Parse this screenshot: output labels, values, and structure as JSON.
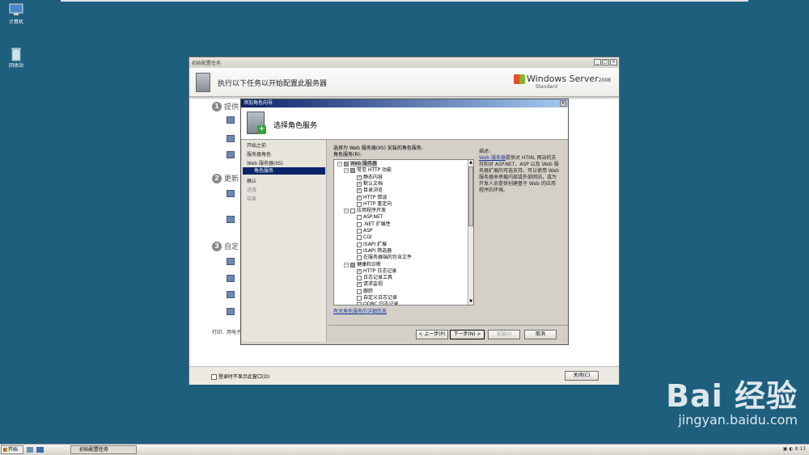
{
  "desktop": {
    "icons": [
      {
        "label": "计算机",
        "icon": "computer-icon"
      },
      {
        "label": "回收站",
        "icon": "recycle-bin-icon"
      }
    ]
  },
  "main_window": {
    "title": "初始配置任务",
    "header_title": "执行以下任务以开始配置此服务器",
    "brand": {
      "name": "Windows Server",
      "year": "2008",
      "edition": "Standard"
    },
    "steps": [
      {
        "num": "1",
        "label": "提供"
      },
      {
        "num": "2",
        "label": "更新"
      },
      {
        "num": "3",
        "label": "自定"
      }
    ],
    "print_text": "打印、用电子",
    "footer_checkbox_label": "登录时不显示此窗口(D)",
    "close_label": "关闭(C)"
  },
  "wizard": {
    "title": "添加角色向导",
    "header_title": "选择角色服务",
    "nav": [
      {
        "label": "开始之前",
        "state": "normal"
      },
      {
        "label": "服务器角色",
        "state": "normal"
      },
      {
        "label": "Web 服务器(IIS)",
        "state": "normal"
      },
      {
        "label": "角色服务",
        "state": "selected"
      },
      {
        "label": "确认",
        "state": "normal"
      },
      {
        "label": "进度",
        "state": "dim"
      },
      {
        "label": "结果",
        "state": "dim"
      }
    ],
    "instruction": "选择为 Web 服务器(IIS) 安装的角色服务:",
    "role_services_label": "角色服务(R):",
    "tree": [
      {
        "label": "Web 服务器",
        "level": 0,
        "expand": "−",
        "check": "partial",
        "selected": true
      },
      {
        "label": "常见 HTTP 功能",
        "level": 1,
        "expand": "−",
        "check": "partial"
      },
      {
        "label": "静态内容",
        "level": 2,
        "check": "checked"
      },
      {
        "label": "默认文档",
        "level": 2,
        "check": "checked"
      },
      {
        "label": "目录浏览",
        "level": 2,
        "check": "checked"
      },
      {
        "label": "HTTP 错误",
        "level": 2,
        "check": "checked"
      },
      {
        "label": "HTTP 重定向",
        "level": 2,
        "check": "unchecked"
      },
      {
        "label": "应用程序开发",
        "level": 1,
        "expand": "−",
        "check": "unchecked"
      },
      {
        "label": "ASP.NET",
        "level": 2,
        "check": "unchecked"
      },
      {
        "label": ".NET 扩展性",
        "level": 2,
        "check": "unchecked"
      },
      {
        "label": "ASP",
        "level": 2,
        "check": "unchecked"
      },
      {
        "label": "CGI",
        "level": 2,
        "check": "unchecked"
      },
      {
        "label": "ISAPI 扩展",
        "level": 2,
        "check": "unchecked"
      },
      {
        "label": "ISAPI 筛选器",
        "level": 2,
        "check": "unchecked"
      },
      {
        "label": "在服务器端的包含文件",
        "level": 2,
        "check": "unchecked"
      },
      {
        "label": "健康和诊断",
        "level": 1,
        "expand": "−",
        "check": "partial"
      },
      {
        "label": "HTTP 日志记录",
        "level": 2,
        "check": "checked"
      },
      {
        "label": "日志记录工具",
        "level": 2,
        "check": "unchecked"
      },
      {
        "label": "请求监视",
        "level": 2,
        "check": "checked"
      },
      {
        "label": "跟踪",
        "level": 2,
        "check": "unchecked"
      },
      {
        "label": "自定义日志记录",
        "level": 2,
        "check": "unchecked"
      },
      {
        "label": "ODBC 日志记录",
        "level": 2,
        "check": "unchecked"
      }
    ],
    "more_info_link": "有关角色服务的详细信息",
    "description_title": "描述:",
    "description_link": "Web 服务器",
    "description_text": "提供对 HTML 网站的支持和对 ASP.NET、ASP 以及 Web 服务器扩展的可选支持。可以使用 Web 服务器来承载内部或外部网站，或为开发人员提供创建基于 Web 的应用程序的环境。",
    "buttons": {
      "back": "< 上一步(P)",
      "next": "下一步(N) >",
      "install": "安装(I)",
      "cancel": "取消"
    }
  },
  "taskbar": {
    "start": "开始",
    "task_label": "初始配置任务",
    "clock": "8:13"
  },
  "watermark": {
    "brand": "Bai 经验",
    "url": "jingyan.baidu.com"
  }
}
